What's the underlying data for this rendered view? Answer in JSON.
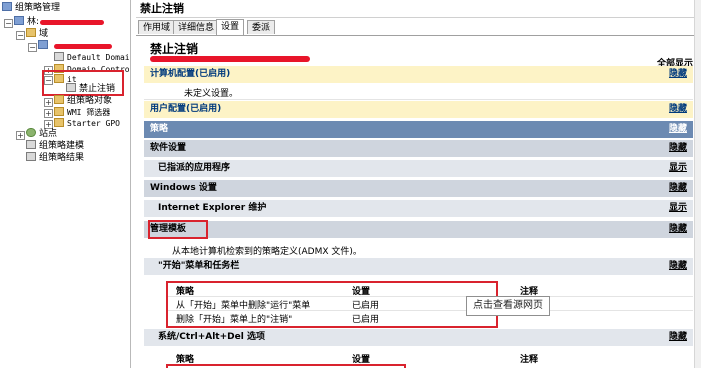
{
  "tree": {
    "root": "组策略管理",
    "forest": "林:",
    "domain": "域",
    "default_domain": "Default Domain",
    "domain_controllers": "Domain Controll",
    "ou_it": "it",
    "selected_gpo": "禁止注销",
    "gpo_objects": "组策略对象",
    "wmi_filters": "WMI 筛选器",
    "starter_gpo": "Starter GPO",
    "sites": "站点",
    "modeling": "组策略建模",
    "results": "组策略结果"
  },
  "panel": {
    "title": "禁止注销",
    "tabs": [
      "作用域",
      "详细信息",
      "设置",
      "委派"
    ],
    "active_tab": 2
  },
  "report": {
    "title": "禁止注销",
    "show_all": "全部显示",
    "computer_config": "计算机配置(已启用)",
    "hide": "隐藏",
    "show": "显示",
    "not_defined": "未定义设置。",
    "user_config": "用户配置(已启用)",
    "policies": "策略",
    "software_settings": "软件设置",
    "assigned_apps": "已指派的应用程序",
    "windows_settings": "Windows 设置",
    "ie_maintenance": "Internet Explorer 维护",
    "admin_templates": "管理模板",
    "admx_note": "从本地计算机检索到的策略定义(ADMX 文件)。",
    "start_menu": "\"开始\"菜单和任务栏",
    "ctrl_alt_del": "系统/Ctrl+Alt+Del 选项",
    "col_policy": "策略",
    "col_setting": "设置",
    "col_comment": "注释",
    "rows": [
      {
        "policy": "从「开始」菜单中删除\"运行\"菜单",
        "setting": "已启用"
      },
      {
        "policy": "删除「开始」菜单上的\"注销\"",
        "setting": "已启用"
      }
    ]
  },
  "tooltip": "点击查看源网页"
}
